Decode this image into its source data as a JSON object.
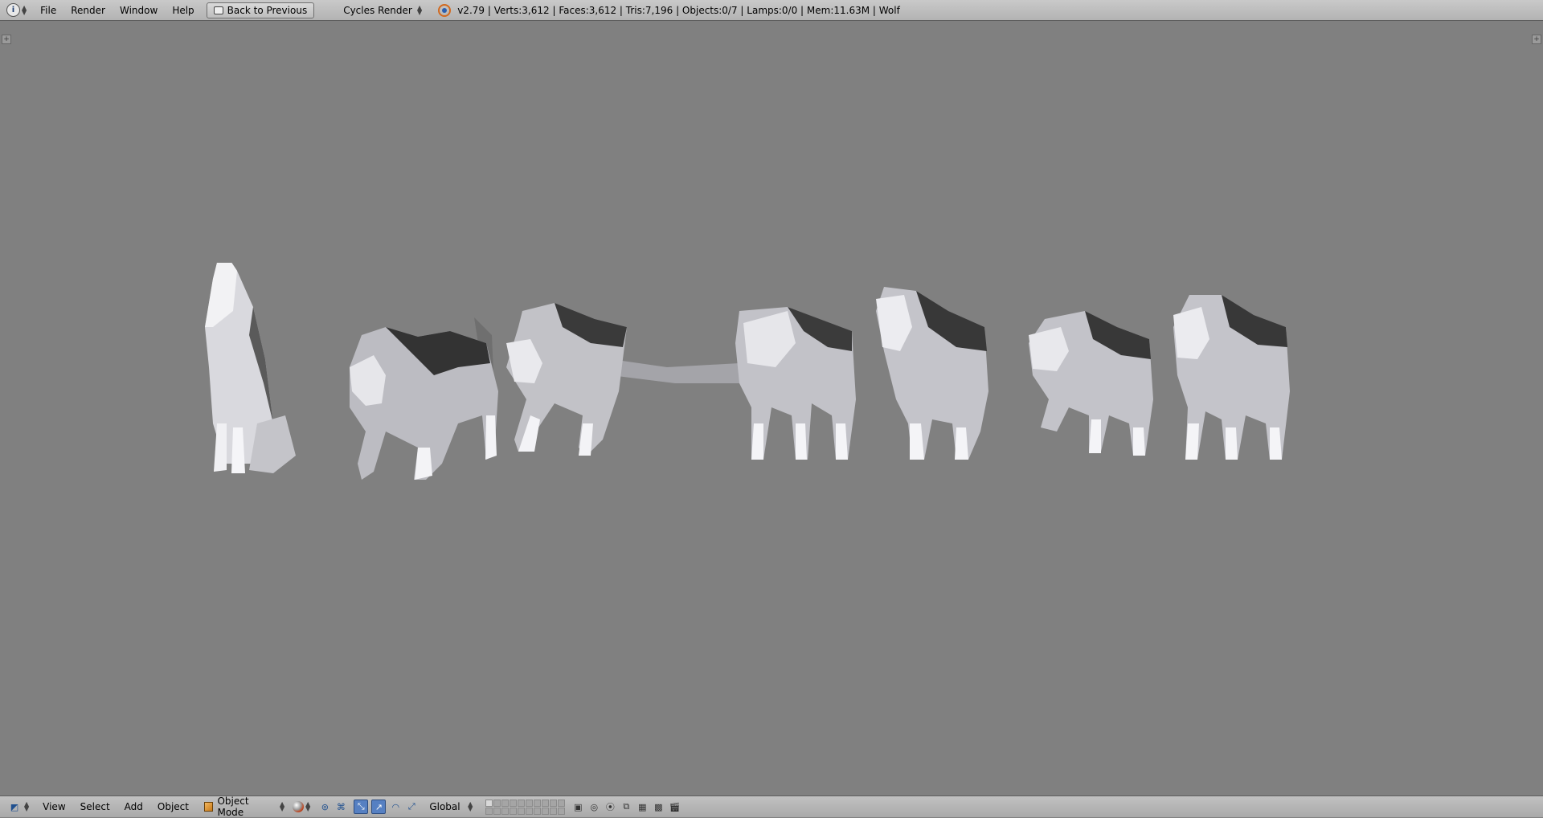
{
  "topbar": {
    "editor_type_icon": "info-icon",
    "menus": [
      "File",
      "Render",
      "Window",
      "Help"
    ],
    "back_button_label": "Back to Previous",
    "render_engine": "Cycles Render",
    "stats": "v2.79 | Verts:3,612 | Faces:3,612 | Tris:7,196 | Objects:0/7 | Lamps:0/0 | Mem:11.63M | Wolf"
  },
  "viewport": {
    "background": "#808080",
    "objects": [
      "wolf-howling",
      "wolf-walking-tail-up",
      "wolf-trotting",
      "wolf-looking-back",
      "wolf-standing",
      "wolf-stepping",
      "wolf-idle"
    ]
  },
  "bottombar": {
    "editor_type_icon": "3d-view-icon",
    "menus": [
      "View",
      "Select",
      "Add",
      "Object"
    ],
    "mode": "Object Mode",
    "orientation": "Global"
  },
  "colors": {
    "header_bg": "#b5b5b5",
    "active_tool": "#5680c2",
    "wolf_light": "#e8e8ec",
    "wolf_mid": "#b9b9bf",
    "wolf_dark": "#3d3d3d"
  }
}
